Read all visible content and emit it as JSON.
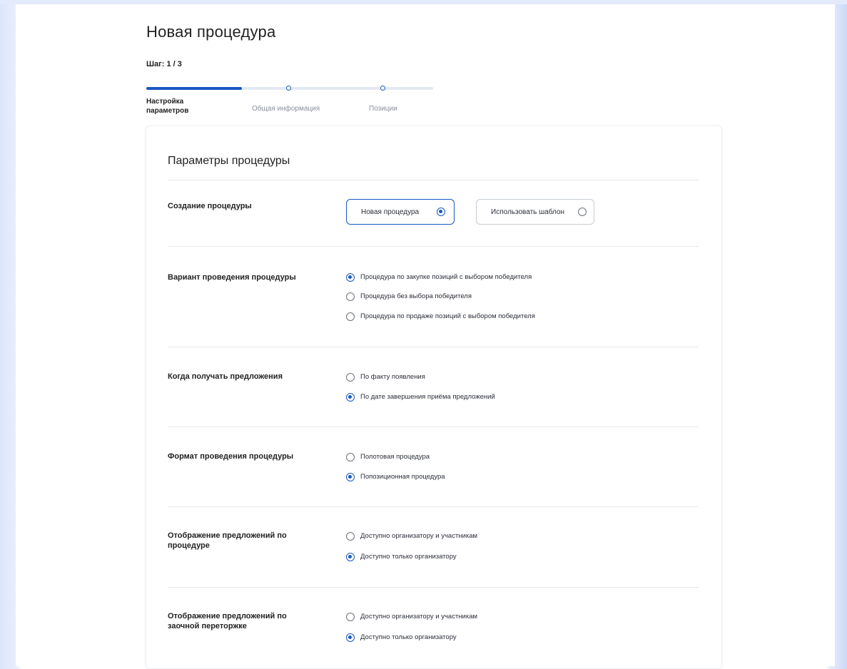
{
  "page": {
    "title": "Новая процедура",
    "step": "Шаг: 1 / 3"
  },
  "stepper": {
    "steps": [
      {
        "label": "Настройка параметров",
        "state": "active"
      },
      {
        "label": "Общая информация",
        "state": "pending"
      },
      {
        "label": "Позиции",
        "state": "pending"
      }
    ],
    "progress_percent": 33
  },
  "card": {
    "title": "Параметры процедуры"
  },
  "creation": {
    "label": "Создание процедуры",
    "options": [
      {
        "label": "Новая процедура",
        "selected": true
      },
      {
        "label": "Использовать шаблон",
        "selected": false
      }
    ]
  },
  "variant": {
    "label": "Вариант проведения процедуры",
    "options": [
      {
        "label": "Процедура по закупке позиций с выбором победителя",
        "selected": true
      },
      {
        "label": "Процедура без выбора победителя",
        "selected": false
      },
      {
        "label": "Процедура по продаже позиций с выбором победителя",
        "selected": false
      }
    ]
  },
  "receive": {
    "label": "Когда получать предложения",
    "options": [
      {
        "label": "По факту появления",
        "selected": false
      },
      {
        "label": "По дате завершения приёма предложений",
        "selected": true
      }
    ]
  },
  "format": {
    "label": "Формат проведения процедуры",
    "options": [
      {
        "label": "Полотовая процедура",
        "selected": false
      },
      {
        "label": "Попозиционная процедура",
        "selected": true
      }
    ]
  },
  "display": {
    "label": "Отображение предложений по процедуре",
    "options": [
      {
        "label": "Доступно организатору и участникам",
        "selected": false
      },
      {
        "label": "Доступно только организатору",
        "selected": true
      }
    ]
  },
  "rebid": {
    "label": "Отображение предложений по заочной переторжке",
    "options": [
      {
        "label": "Доступно организатору и участникам",
        "selected": false
      },
      {
        "label": "Доступно только организатору",
        "selected": true
      }
    ]
  },
  "colors": {
    "accent": "#1b57c4",
    "track": "#e3e9f3",
    "text": "#222222",
    "muted": "#8a909c"
  }
}
